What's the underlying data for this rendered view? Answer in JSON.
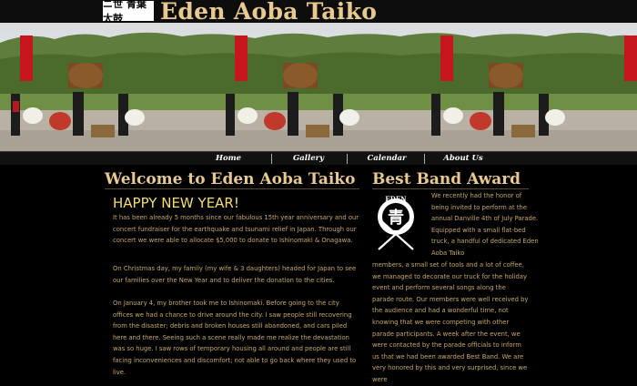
{
  "header": {
    "logo_text": "ニ世 青葉太鼓",
    "site_title": "Eden Aoba Taiko"
  },
  "nav": {
    "items": [
      "Home",
      "Gallery",
      "Calendar",
      "About Us"
    ]
  },
  "main": {
    "heading": "Welcome to Eden Aoba Taiko",
    "happy": "HAPPY NEW YEAR!",
    "paragraphs": [
      "It has been already 5 months since our fabulous 15th year anniversary and our concert fundraiser for the earthquake and tsunami relief in Japan. Through our concert we were able to allocate $5,000 to donate to Ishinomaki & Onagawa.",
      "On Christmas day, my family (my wife & 3 daughters) headed for Japan to see our families over the New Year and to deliver the donation to the cities.",
      "On January 4, my brother took me to Ishinomaki. Before going to the city offices we had a chance to drive around the city. I saw people still recovering from the disaster; debris and broken houses still abandoned, and cars piled here and there. Seeing such a scene really made me realize the devastation was so huge. I saw rows of temporary housing all around and people are still facing inconveniences and discomfort; not able to go back where they used to live."
    ]
  },
  "side": {
    "heading": "Best Band Award",
    "emblem_text": "EDEN",
    "wrap_text": "We recently had the honor of being invited to perform at the annual Danville 4th of July Parade. Equipped with a small flat-bed truck, a handful of dedicated Eden Aoba Taiko",
    "full_text": "members, a small set of tools and a lot of coffee, we managed to decorate our truck for the holiday event and perform several songs along the parade route. Our members were well received by the audience and had a wonderful time, not knowing that we were competing with other parade participants. A week after the event, we were contacted by the parade officials to inform us that we had been awarded Best Band. We are very honored by this and very surprised, since we were"
  }
}
